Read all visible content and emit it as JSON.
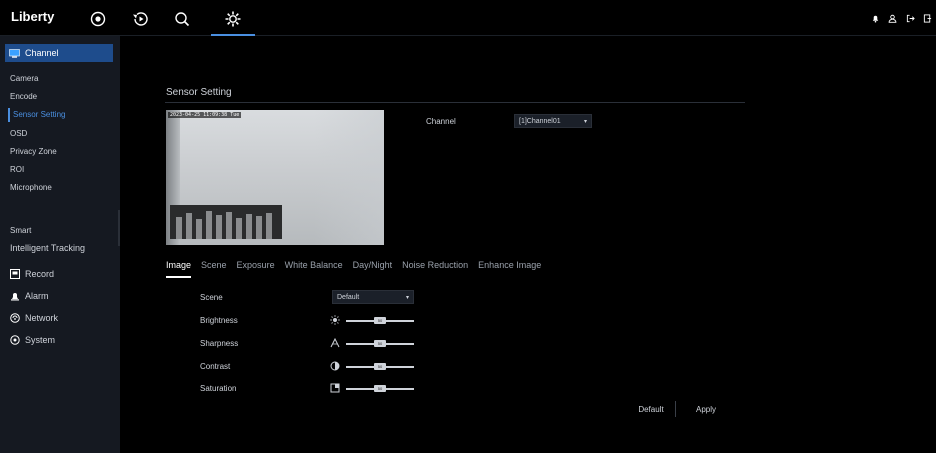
{
  "app": {
    "brand": "Liberty"
  },
  "top_nav": {
    "icons": [
      "live-view-icon",
      "playback-icon",
      "search-icon",
      "settings-icon"
    ],
    "right_icons": [
      "bell-icon",
      "user-icon",
      "logout-icon",
      "exit-icon"
    ]
  },
  "sidebar": {
    "channel_label": "Channel",
    "items": [
      "Camera",
      "Encode",
      "Sensor Setting",
      "OSD",
      "Privacy Zone",
      "ROI",
      "Microphone"
    ],
    "smart_label": "Smart",
    "smart_item": "Intelligent Tracking",
    "sections": [
      "Record",
      "Alarm",
      "Network",
      "System"
    ]
  },
  "page": {
    "title": "Sensor Setting",
    "channel_label": "Channel",
    "channel_value": "[1]Channel01",
    "osd_text": "2023-04-25 11:09:38 Tue"
  },
  "tabs": [
    "Image",
    "Scene",
    "Exposure",
    "White Balance",
    "Day/Night",
    "Noise Reduction",
    "Enhance Image"
  ],
  "form": {
    "scene_label": "Scene",
    "scene_value": "Default",
    "brightness_label": "Brightness",
    "brightness_value": "50",
    "sharpness_label": "Sharpness",
    "sharpness_value": "50",
    "contrast_label": "Contrast",
    "contrast_value": "50",
    "saturation_label": "Saturation",
    "saturation_value": "50"
  },
  "buttons": {
    "default": "Default",
    "apply": "Apply"
  },
  "colors": {
    "accent": "#4a8fe0",
    "sidebar_bg": "#151921",
    "selected_bg": "#1e4c8c"
  }
}
